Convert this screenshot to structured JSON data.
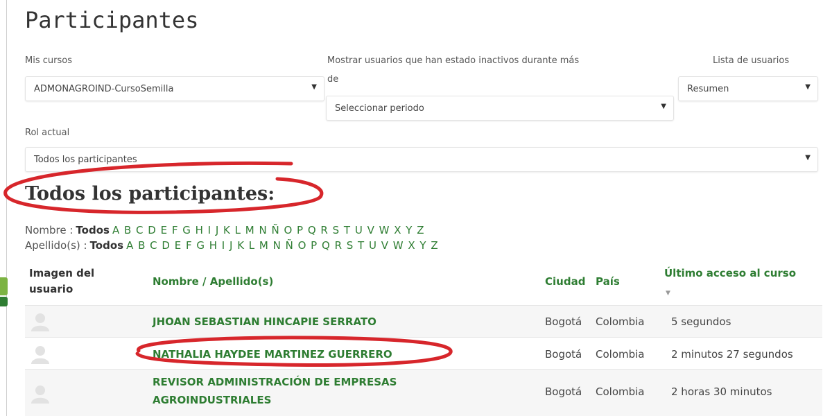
{
  "page": {
    "title": "Participantes"
  },
  "filters": {
    "courses_label": "Mis cursos",
    "courses_value": "ADMONAGROIND-CursoSemilla",
    "inactive_label_line1": "Mostrar usuarios que han estado inactivos durante más",
    "inactive_label_line2": "de",
    "inactive_value": "Seleccionar periodo",
    "list_label": "Lista de usuarios",
    "list_value": "Resumen",
    "role_label": "Rol actual",
    "role_value": "Todos los participantes"
  },
  "section": {
    "title": "Todos los participantes:"
  },
  "letter_filters": {
    "first_name_label": "Nombre :",
    "last_name_label": "Apellido(s) :",
    "all": "Todos",
    "letters": "A B C D E F G H I J K L M N Ñ O P Q R S T U V W X Y Z"
  },
  "table": {
    "headers": {
      "image_line1": "Imagen del",
      "image_line2": "usuario",
      "name": "Nombre / Apellido(s)",
      "city": "Ciudad",
      "country": "País",
      "last_access": "Último acceso al curso"
    },
    "rows": [
      {
        "name_line1": "JHOAN SEBASTIAN HINCAPIE SERRATO",
        "name_line2": "",
        "city": "Bogotá",
        "country": "Colombia",
        "last_access": "5 segundos"
      },
      {
        "name_line1": "NATHALIA HAYDEE MARTINEZ GUERRERO",
        "name_line2": "",
        "city": "Bogotá",
        "country": "Colombia",
        "last_access": "2 minutos 27 segundos"
      },
      {
        "name_line1": "REVISOR ADMINISTRACIÓN DE EMPRESAS",
        "name_line2": "AGROINDUSTRIALES",
        "city": "Bogotá",
        "country": "Colombia",
        "last_access": "2 horas 30 minutos"
      }
    ]
  },
  "annotation_color": "#d7262b",
  "accent_color": "#2e7d32"
}
